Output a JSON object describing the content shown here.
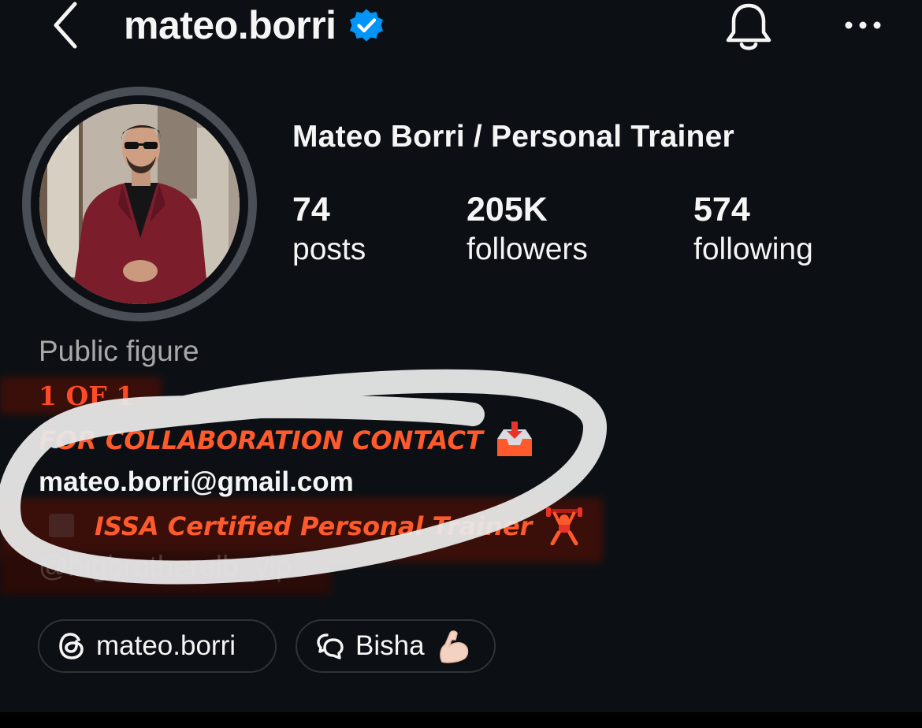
{
  "header": {
    "username": "mateo.borri",
    "verified": true,
    "icons": {
      "back": "chevron-left-icon",
      "verified": "verified-badge-icon",
      "notifications": "bell-icon",
      "more": "more-horizontal-icon"
    }
  },
  "profile": {
    "display_name": "Mateo Borri / Personal Trainer",
    "stats": [
      {
        "value": "74",
        "label": "posts"
      },
      {
        "value": "205K",
        "label": "followers"
      },
      {
        "value": "574",
        "label": "following"
      }
    ]
  },
  "bio": {
    "category": "Public figure",
    "line1": "1 OF 1",
    "line2": "FOR COLLABORATION CONTACT",
    "line2_emoji": "inbox-tray-icon",
    "email": "mateo.borri@gmail.com",
    "line4": "ISSA Certified Personal Trainer",
    "line4_emoji": "weightlifter-icon",
    "handle": "@bigbrotheralb_vip"
  },
  "links": [
    {
      "label": "mateo.borri",
      "icon": "threads-icon"
    },
    {
      "label": "Bisha",
      "icon": "chat-bubbles-icon",
      "emoji": "flexed-biceps-icon"
    }
  ],
  "colors": {
    "background": "#0c1014",
    "text": "#f5f5f5",
    "secondary": "#a8a8a8",
    "verified": "#0095f6",
    "bio_accent": "#ff4a25",
    "annotation_mark": "#e9e9e9"
  }
}
